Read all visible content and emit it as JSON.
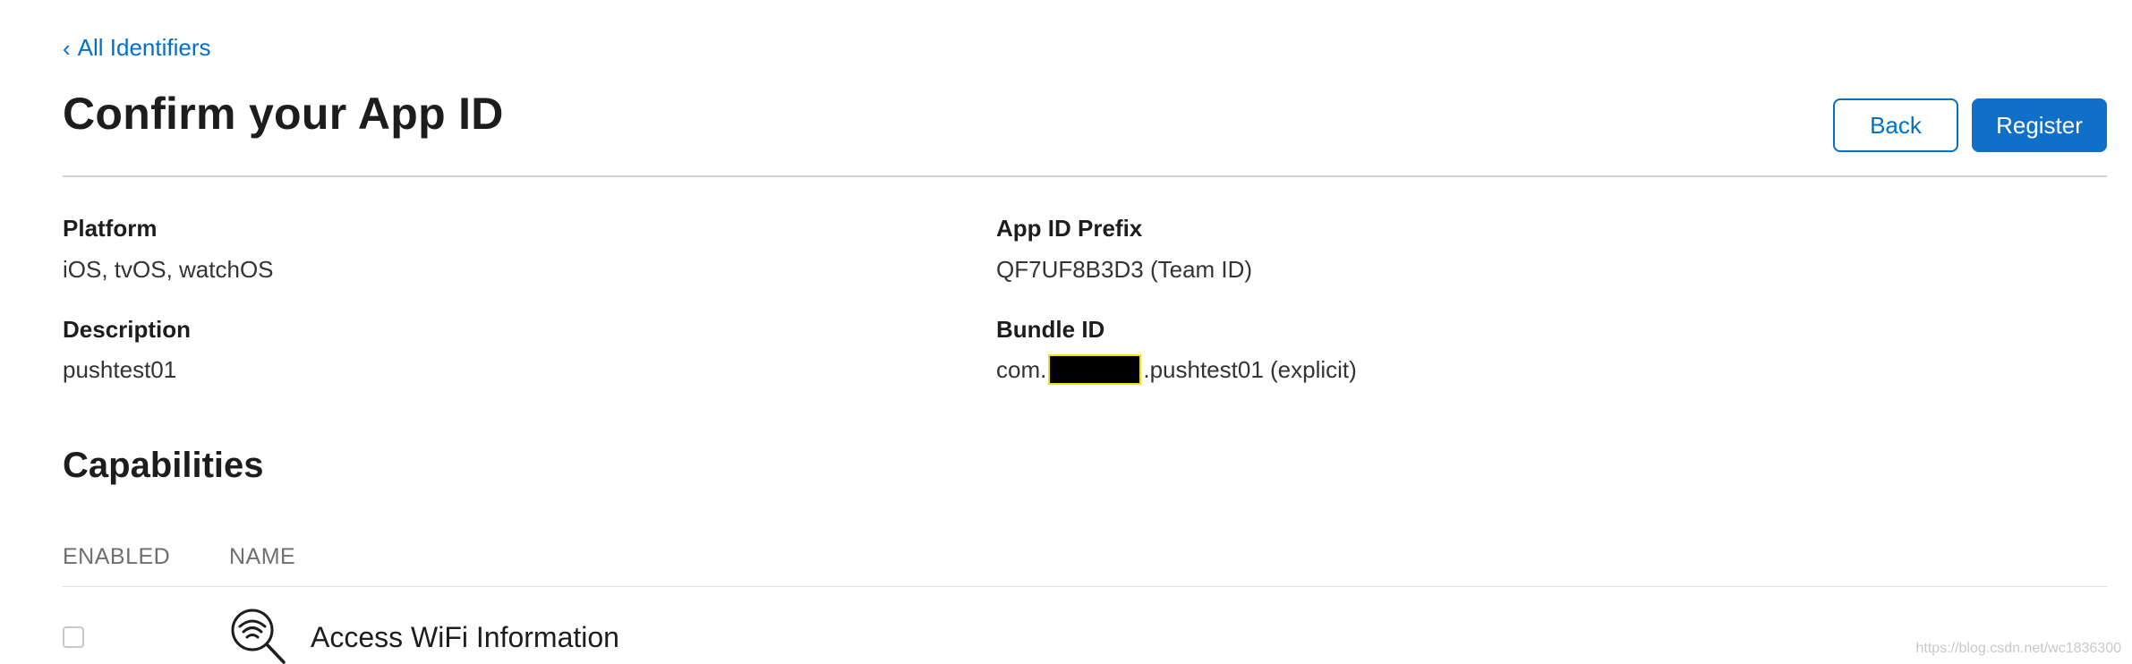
{
  "nav": {
    "back_link": "All Identifiers"
  },
  "header": {
    "title": "Confirm your App ID",
    "back_button": "Back",
    "register_button": "Register"
  },
  "details": {
    "platform_label": "Platform",
    "platform_value": "iOS, tvOS, watchOS",
    "prefix_label": "App ID Prefix",
    "prefix_value": "QF7UF8B3D3 (Team ID)",
    "description_label": "Description",
    "description_value": "pushtest01",
    "bundle_label": "Bundle ID",
    "bundle_value_prefix": "com.",
    "bundle_value_suffix": ".pushtest01 (explicit)"
  },
  "capabilities": {
    "title": "Capabilities",
    "columns": [
      "ENABLED",
      "NAME"
    ],
    "rows": [
      {
        "name": "Access WiFi Information",
        "enabled": false,
        "icon": "wifi-search-icon"
      }
    ]
  },
  "watermark": "https://blog.csdn.net/wc1836300"
}
